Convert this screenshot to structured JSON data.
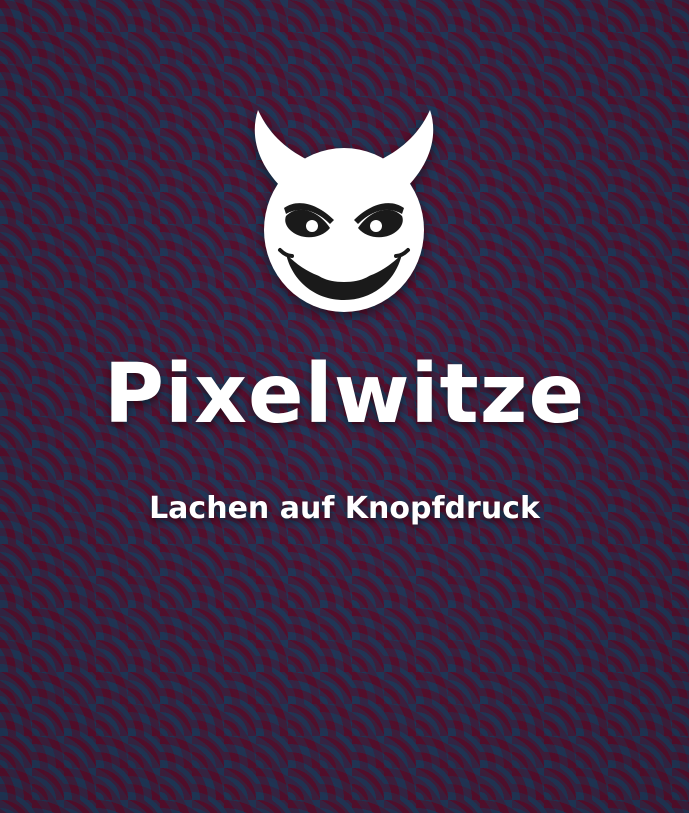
{
  "hero": {
    "title": "Pixelwitze",
    "subtitle": "Lachen auf Knopfdruck",
    "logo_icon": "devil-face-icon"
  },
  "colors": {
    "pattern_blue": "#213a5c",
    "pattern_red": "#5a0f2e",
    "text": "#ffffff"
  }
}
